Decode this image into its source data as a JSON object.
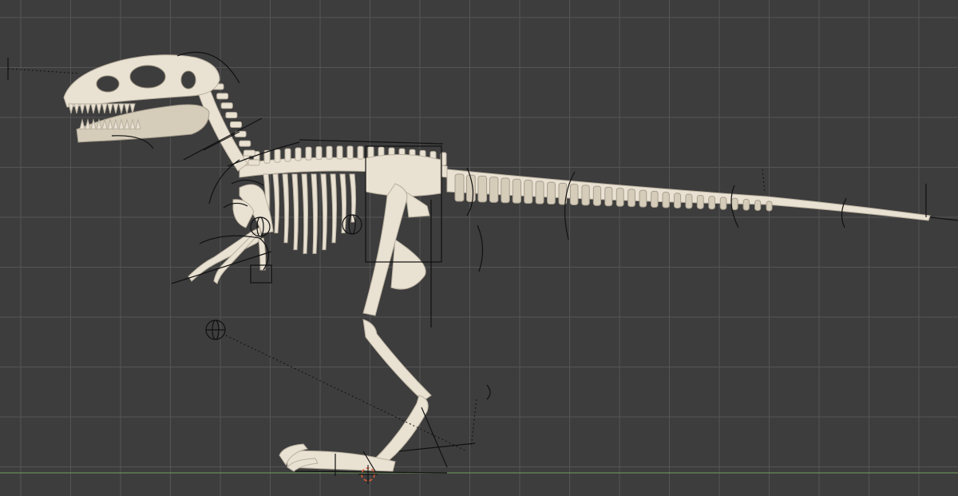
{
  "viewport": {
    "background_color": "#3d3d3d",
    "grid_color": "#555555",
    "horizon_color": "#6a8a5a",
    "bone_color": "#e9e1d2",
    "rig_line_color": "#111111"
  },
  "scene": {
    "subject": "dinosaur-skeleton-rig",
    "icons": [
      "empty-sphere-icon",
      "3d-cursor-icon"
    ]
  }
}
